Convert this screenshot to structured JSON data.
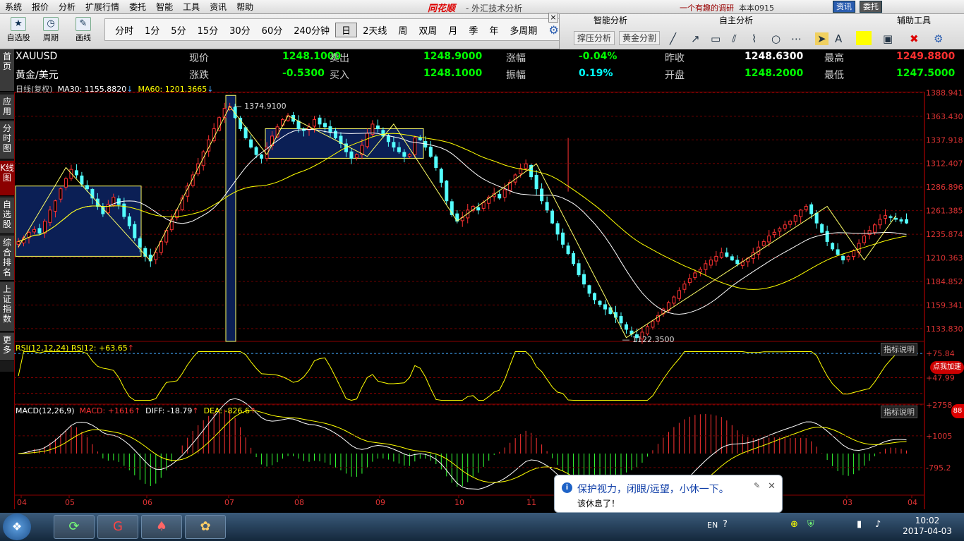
{
  "menu": {
    "items": [
      "系统",
      "报价",
      "分析",
      "扩展行情",
      "委托",
      "智能",
      "工具",
      "资讯",
      "帮助"
    ],
    "brand": "同花顺",
    "brand_sub": "- 外汇技术分析",
    "right_link": "一个有趣的调研",
    "user": "本本0915",
    "btn_news": "资讯",
    "btn_trade": "委托"
  },
  "toolbar": {
    "left_buttons": [
      "自选股",
      "周期",
      "画线"
    ],
    "periods": [
      "分时",
      "1分",
      "5分",
      "15分",
      "30分",
      "60分",
      "240分钟",
      "日",
      "2天线",
      "周",
      "双周",
      "月",
      "季",
      "年",
      "多周期"
    ],
    "selected_period": "日"
  },
  "right_panel": {
    "smart": "智能分析",
    "self": "自主分析",
    "aux": "辅助工具",
    "btn1": "撑压分析",
    "btn2": "黄金分割"
  },
  "sidebar": [
    {
      "label": "首页",
      "sel": false
    },
    {
      "label": "应用",
      "sel": false
    },
    {
      "label": "分时图",
      "sel": false
    },
    {
      "label": "K线图",
      "sel": true
    },
    {
      "label": "自选股",
      "sel": false
    },
    {
      "label": "综合排名",
      "sel": false
    },
    {
      "label": "上证指数",
      "sel": false
    },
    {
      "label": "更多",
      "sel": false
    }
  ],
  "quote": {
    "symbol": "XAUUSD",
    "name": "黄金/美元",
    "row1": [
      {
        "label": "现价",
        "value": "1248.1000",
        "color": "#00ff00"
      },
      {
        "label": "卖出",
        "value": "1248.9000",
        "color": "#00ff00"
      },
      {
        "label": "涨幅",
        "value": "-0.04%",
        "color": "#00ff00"
      },
      {
        "label": "昨收",
        "value": "1248.6300",
        "color": "#ffffff"
      },
      {
        "label": "最高",
        "value": "1249.8800",
        "color": "#ff3030"
      }
    ],
    "row2": [
      {
        "label": "涨跌",
        "value": "-0.5300",
        "color": "#00ff00"
      },
      {
        "label": "买入",
        "value": "1248.1000",
        "color": "#00ff00"
      },
      {
        "label": "振幅",
        "value": "0.19%",
        "color": "#00ffff"
      },
      {
        "label": "开盘",
        "value": "1248.2000",
        "color": "#00ff00"
      },
      {
        "label": "最低",
        "value": "1247.5000",
        "color": "#00ff00"
      }
    ]
  },
  "kline_header": {
    "title": "日线(复权)",
    "ma30": "MA30: 1155.8820",
    "ma60": "MA60: 1201.3665"
  },
  "rsi_header": "RSI(12,12,24) RSI12: +63.65",
  "macd_header": {
    "name": "MACD(12,26,9)",
    "macd": "MACD: +1616",
    "diff": "DIFF: -18.79",
    "dea": "DEA: -826.6"
  },
  "indicator_btn": "指标说明",
  "annotations": {
    "high": "1374.9100",
    "low": "1122.3500"
  },
  "chart_data": [
    {
      "type": "candlestick",
      "title": "日线(复权)",
      "ylim": [
        1120,
        1390
      ],
      "y_ticks": [
        "1388.941",
        "1363.430",
        "1337.918",
        "1312.407",
        "1286.896",
        "1261.385",
        "1235.874",
        "1210.363",
        "1184.852",
        "1159.341",
        "1133.830"
      ],
      "x_ticks": [
        "04",
        "05",
        "06",
        "07",
        "08",
        "09",
        "10",
        "11",
        "03",
        "04"
      ],
      "close": [
        1228,
        1232,
        1238,
        1241,
        1237,
        1250,
        1262,
        1272,
        1285,
        1296,
        1306,
        1300,
        1290,
        1285,
        1275,
        1266,
        1258,
        1268,
        1276,
        1268,
        1255,
        1245,
        1232,
        1222,
        1212,
        1207,
        1216,
        1228,
        1240,
        1252,
        1262,
        1275,
        1288,
        1300,
        1312,
        1325,
        1338,
        1350,
        1362,
        1372,
        1374,
        1362,
        1350,
        1340,
        1330,
        1322,
        1318,
        1330,
        1342,
        1352,
        1360,
        1364,
        1358,
        1350,
        1348,
        1352,
        1360,
        1355,
        1352,
        1346,
        1340,
        1334,
        1325,
        1318,
        1322,
        1332,
        1345,
        1355,
        1350,
        1342,
        1336,
        1330,
        1325,
        1320,
        1322,
        1340,
        1338,
        1330,
        1320,
        1308,
        1292,
        1272,
        1257,
        1250,
        1254,
        1262,
        1266,
        1262,
        1270,
        1276,
        1280,
        1275,
        1284,
        1292,
        1300,
        1307,
        1312,
        1298,
        1285,
        1272,
        1262,
        1248,
        1236,
        1225,
        1215,
        1204,
        1192,
        1182,
        1172,
        1165,
        1160,
        1155,
        1150,
        1146,
        1140,
        1133,
        1128,
        1124,
        1130,
        1136,
        1142,
        1148,
        1155,
        1162,
        1168,
        1175,
        1182,
        1188,
        1194,
        1198,
        1204,
        1208,
        1212,
        1216,
        1212,
        1208,
        1204,
        1206,
        1210,
        1216,
        1222,
        1228,
        1234,
        1238,
        1242,
        1246,
        1250,
        1256,
        1262,
        1266,
        1258,
        1248,
        1238,
        1228,
        1220,
        1214,
        1208,
        1212,
        1218,
        1226,
        1234,
        1240,
        1246,
        1252,
        1256,
        1254,
        1252,
        1250,
        1248
      ],
      "ma30_label": "MA30",
      "ma60_label": "MA60",
      "high_label": "1374.9100",
      "low_label": "1122.3500"
    },
    {
      "type": "line",
      "title": "RSI(12,12,24)",
      "ylim": [
        20,
        80
      ],
      "y_ticks": [
        "+75.84",
        "+47.99"
      ]
    },
    {
      "type": "bar+line",
      "title": "MACD(12,26,9)",
      "ylim": [
        -4000,
        4000
      ],
      "y_ticks": [
        "+2758",
        "+1005",
        "-795.2"
      ]
    }
  ],
  "taskbar": {
    "time": "10:02",
    "date": "2017-04-03",
    "lang": "EN"
  },
  "popup": {
    "title": "保护视力，闭眼/远望，小休一下。",
    "text": "该休息了！"
  },
  "badge": "点我加速",
  "badge_num": "88"
}
